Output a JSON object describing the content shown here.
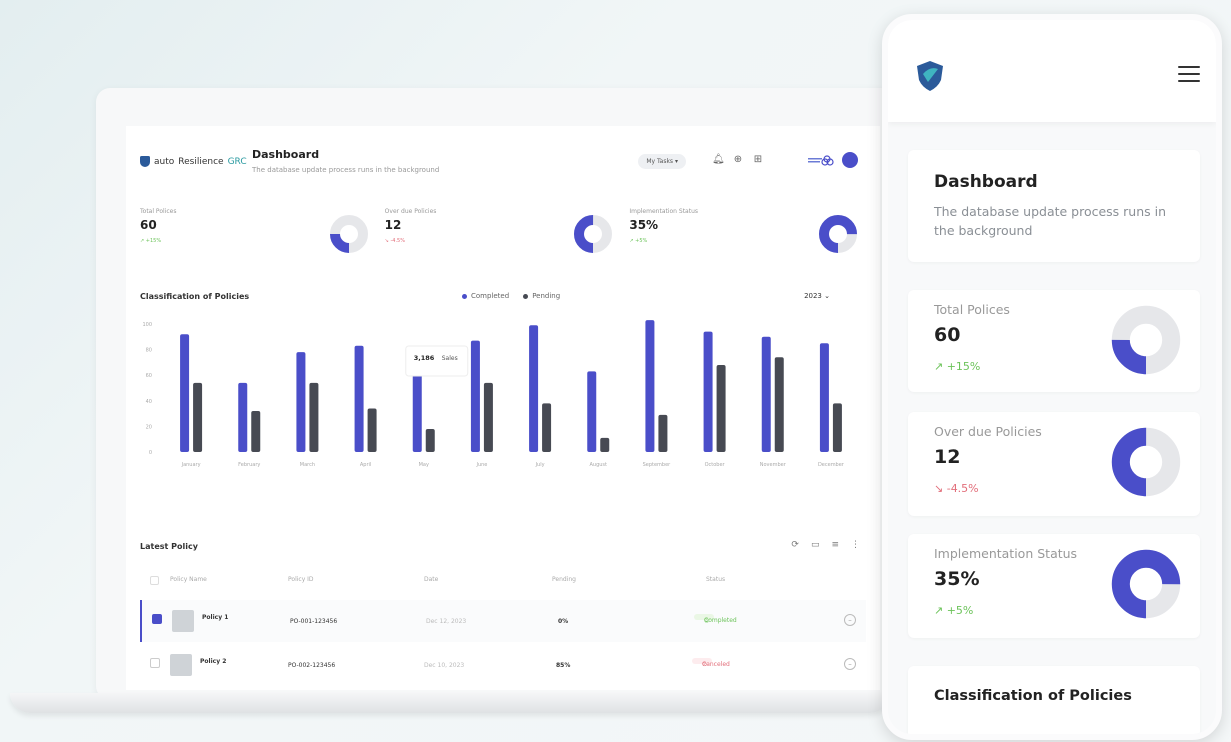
{
  "desktop": {
    "brand": {
      "prefix": "auto",
      "name": "Resilience",
      "suffix": "GRC"
    },
    "header": {
      "title": "Dashboard",
      "subtitle": "The database update process runs in the background",
      "tasks_label": "My Tasks",
      "icons": [
        "bell-icon",
        "globe-icon",
        "grid-icon",
        "brand-mark",
        "avatar"
      ]
    },
    "stats": [
      {
        "label": "Total Polices",
        "value": "60",
        "change": "+15%",
        "trend": "up",
        "fraction": 0.25
      },
      {
        "label": "Over due Policies",
        "value": "12",
        "change": "-4.5%",
        "trend": "down",
        "fraction": 0.5
      },
      {
        "label": "Implementation Status",
        "value": "35%",
        "change": "+5%",
        "trend": "up",
        "fraction": 0.75
      }
    ],
    "classification": {
      "title": "Classification of Policies",
      "legend": [
        "Completed",
        "Pending"
      ],
      "year": "2023",
      "tooltip": {
        "value": "3,186",
        "unit": "Sales"
      }
    },
    "latest_policy": {
      "title": "Latest Policy",
      "columns": [
        "Policy Name",
        "Policy ID",
        "Date",
        "Pending",
        "Status"
      ],
      "rows": [
        {
          "name": "Policy 1",
          "id": "PO-001-123456",
          "date": "Dec 12, 2023",
          "pending": "0%",
          "status": "Completed",
          "selected": true
        },
        {
          "name": "Policy 2",
          "id": "PO-002-123456",
          "date": "Dec 10, 2023",
          "pending": "85%",
          "status": "Canceled",
          "selected": false
        }
      ]
    }
  },
  "chart_data": {
    "type": "bar",
    "categories": [
      "January",
      "February",
      "March",
      "April",
      "May",
      "June",
      "July",
      "August",
      "September",
      "October",
      "November",
      "December"
    ],
    "series": [
      {
        "name": "Completed",
        "values": [
          92,
          54,
          78,
          83,
          62,
          87,
          99,
          63,
          103,
          94,
          90,
          85
        ]
      },
      {
        "name": "Pending",
        "values": [
          54,
          32,
          54,
          34,
          18,
          54,
          38,
          11,
          29,
          68,
          74,
          38
        ]
      }
    ],
    "ylim": [
      0,
      100
    ],
    "yticks": [
      "100",
      "80",
      "60",
      "40",
      "20",
      "0"
    ],
    "colors": {
      "Completed": "#4a4ec9",
      "Pending": "#474a53"
    },
    "grid": false,
    "legend": "top-center"
  },
  "mobile": {
    "title": "Dashboard",
    "subtitle": "The database update process runs in the background",
    "stats": [
      {
        "label": "Total Polices",
        "value": "60",
        "change": "+15%",
        "trend": "up",
        "fraction": 0.25
      },
      {
        "label": "Over due Policies",
        "value": "12",
        "change": "-4.5%",
        "trend": "down",
        "fraction": 0.5
      },
      {
        "label": "Implementation Status",
        "value": "35%",
        "change": "+5%",
        "trend": "up",
        "fraction": 0.75
      }
    ],
    "section_title": "Classification of Policies"
  },
  "colors": {
    "accent": "#4a4ec9",
    "dark_bar": "#474a53",
    "up": "#6cc35a",
    "down": "#e26e7a",
    "track": "#e6e7ea"
  }
}
